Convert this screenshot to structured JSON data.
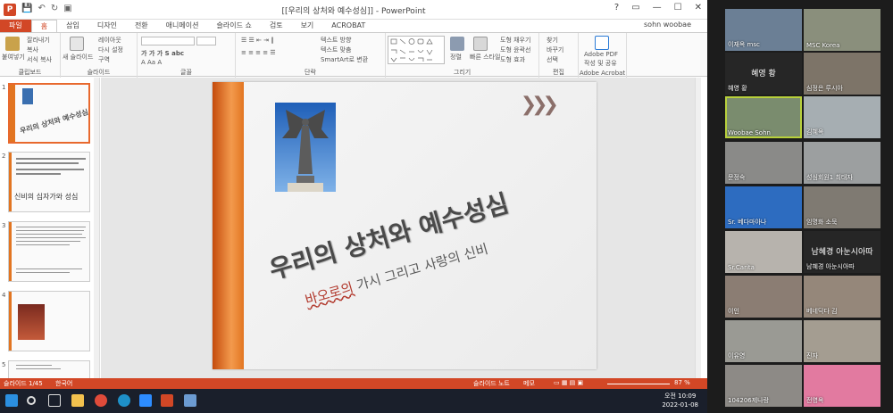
{
  "app": {
    "window_title": "[[우리의 상처와 예수성심]] - PowerPoint",
    "user": "sohn woobae",
    "tabs": [
      "파일",
      "홈",
      "삽입",
      "디자인",
      "전환",
      "애니메이션",
      "슬라이드 쇼",
      "검토",
      "보기",
      "ACROBAT"
    ],
    "active_tab": "홈"
  },
  "ribbon": {
    "clipboard": {
      "label": "클립보드",
      "paste": "붙여넣기",
      "cut": "잘라내기",
      "copy": "복사",
      "format": "서식 복사"
    },
    "slides": {
      "label": "슬라이드",
      "new_slide": "새 슬라이드",
      "layout": "레이아웃",
      "reset": "다시 설정",
      "section": "구역"
    },
    "font": {
      "label": "글꼴"
    },
    "paragraph": {
      "label": "단락",
      "text_dir": "텍스트 방향",
      "align_text": "텍스트 맞춤",
      "smartart": "SmartArt로 변환"
    },
    "drawing": {
      "label": "그리기",
      "arrange": "정렬",
      "quick_styles": "빠른 스타일",
      "fill": "도형 채우기",
      "outline": "도형 윤곽선",
      "effects": "도형 효과"
    },
    "editing": {
      "label": "편집",
      "find": "찾기",
      "replace": "바꾸기",
      "select": "선택"
    },
    "acrobat": {
      "label": "Adobe Acrobat",
      "create": "Adobe PDF",
      "create2": "작성 및 공유"
    }
  },
  "thumbnails": [
    {
      "num": "1"
    },
    {
      "num": "2",
      "title": "신비의 십자가와 성심"
    },
    {
      "num": "3"
    },
    {
      "num": "4"
    },
    {
      "num": "5"
    }
  ],
  "slide": {
    "title": "우리의 상처와 예수성심",
    "subtitle_underlined": "바오로의",
    "subtitle_rest": " 가시 그리고 사랑의 신비",
    "chevrons": "❯❯❯"
  },
  "status": {
    "slide_counter": "슬라이드 1/45",
    "language": "한국어",
    "notes": "슬라이드 노트",
    "comments": "메모",
    "zoom": "87 %"
  },
  "taskbar": {
    "time": "오전 10:09",
    "date": "2022-01-08"
  },
  "participants": [
    {
      "name": "이재옥 msc",
      "color": "#6b7f95"
    },
    {
      "name": "MSC Korea",
      "color": "#8a8f7c"
    },
    {
      "name": "혜영 황",
      "color": "#1c1c1c",
      "name_only": true,
      "big_name": "혜영 황"
    },
    {
      "name": "심정은 루시아",
      "color": "#7d7468"
    },
    {
      "name": "Woobae Sohn",
      "color": "#7a8c6e",
      "active": true
    },
    {
      "name": "김혜옥",
      "color": "#a6aeb2"
    },
    {
      "name": "문정숙",
      "color": "#8a8a88"
    },
    {
      "name": "성심회원1 최태자",
      "color": "#9c9fa0"
    },
    {
      "name": "Sr. 베다마아나",
      "color": "#2d6cc0"
    },
    {
      "name": "임명화 소묵",
      "color": "#7f7a72"
    },
    {
      "name": "Sr.Carita",
      "color": "#b7b3ad"
    },
    {
      "name": "남혜경 아눈시아따",
      "color": "#1c1c1c",
      "name_only": true,
      "big_name": "남혜경 아눈시아따"
    },
    {
      "name": "이인",
      "color": "#8b7d73"
    },
    {
      "name": "베네딕다 김",
      "color": "#95877a"
    },
    {
      "name": "이유영",
      "color": "#9a9a94"
    },
    {
      "name": "진자",
      "color": "#a49d91"
    },
    {
      "name": "104206제나랑",
      "color": "#8d8a86"
    },
    {
      "name": "전영옥",
      "color": "#e27aa0"
    }
  ]
}
